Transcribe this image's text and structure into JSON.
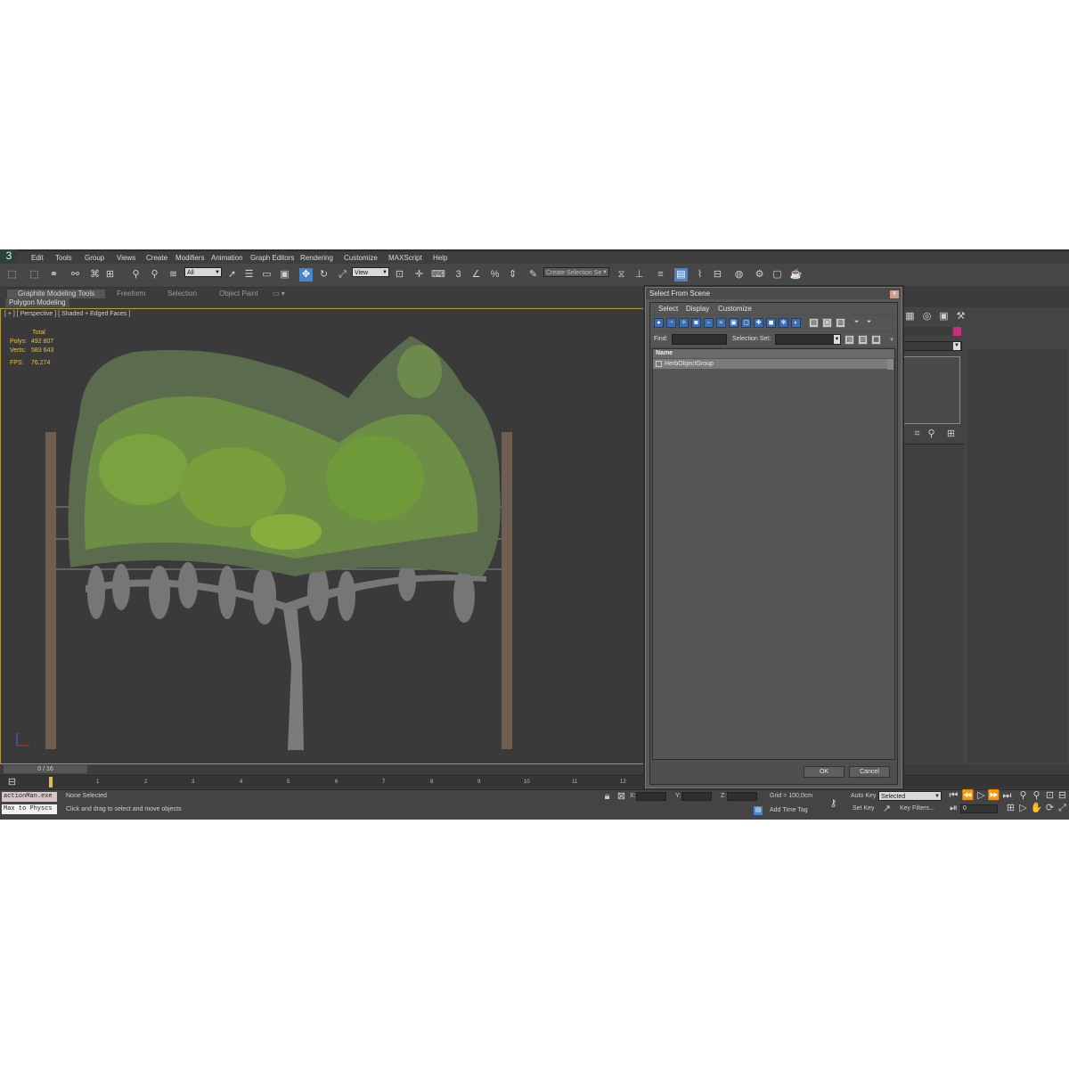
{
  "menu": {
    "logo": "3",
    "items": [
      "Edit",
      "Tools",
      "Group",
      "Views",
      "Create",
      "Modifiers",
      "Animation",
      "Graph Editors",
      "Rendering",
      "Customize",
      "MAXScript",
      "Help"
    ]
  },
  "toolbar": {
    "filter_dropdown": "All",
    "ref_coord_dropdown": "View",
    "selection_set_dropdown": "Create Selection Se",
    "snap_label": "3"
  },
  "ribbon": {
    "tabs": [
      "Graphite Modeling Tools",
      "Freeform",
      "Selection",
      "Object Paint"
    ],
    "sub": "Polygon Modeling"
  },
  "viewport": {
    "label": "[ + ] [ Perspective ] [ Shaded + Edged Faces ]",
    "stats": {
      "header": "Total",
      "polys_label": "Polys:",
      "polys": "492 807",
      "verts_label": "Verts:",
      "verts": "583 643",
      "fps_label": "FPS:",
      "fps": "76,274"
    }
  },
  "dialog": {
    "title": "Select From Scene",
    "close": "x",
    "menu": [
      "Select",
      "Display",
      "Customize"
    ],
    "find_label": "Find:",
    "selection_set_label": "Selection Set:",
    "column": "Name",
    "rows": [
      "HerbObjectGroup"
    ],
    "ok": "OK",
    "cancel": "Cancel"
  },
  "timeline": {
    "frame": "0 / 16",
    "ticks": [
      "1",
      "2",
      "3",
      "4",
      "5",
      "6",
      "7",
      "8",
      "9",
      "10",
      "11",
      "12"
    ]
  },
  "status": {
    "listener_1": "actionMan.exe",
    "listener_2": "Max to Physcs",
    "selection": "None Selected",
    "prompt": "Click and drag to select and move objects",
    "x_label": "X:",
    "y_label": "Y:",
    "z_label": "Z:",
    "grid": "Grid = 100,0cm",
    "add_time_tag": "Add Time Tag",
    "auto_key": "Auto Key",
    "set_key": "Set Key",
    "key_mode": "Selected",
    "key_filters": "Key Filters...",
    "frame_value": "0"
  },
  "colors": {
    "accent": "#4a86c7",
    "viewport_border": "#b59a3a",
    "stats": "#e2c24a",
    "foliage": "#6f9a3a"
  }
}
